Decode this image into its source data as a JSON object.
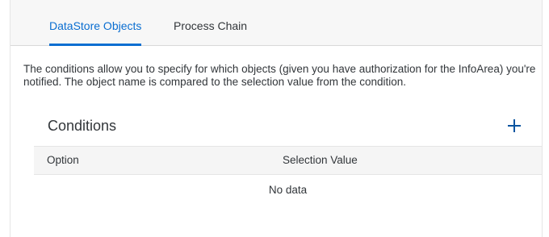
{
  "tabs": [
    {
      "label": "DataStore Objects",
      "selected": true
    },
    {
      "label": "Process Chain",
      "selected": false
    }
  ],
  "description": "The conditions allow you to specify for which objects (given you have authorization for the InfoArea) you're notified. The object name is compared to the selection value from the condition.",
  "conditions": {
    "title": "Conditions",
    "add_icon": "plus-icon",
    "columns": [
      "Option",
      "Selection Value"
    ],
    "rows": [],
    "empty_text": "No data"
  },
  "colors": {
    "accent": "#0a6ed1",
    "text": "#32363a",
    "header_bg": "#f7f7f7",
    "add_icon": "#0854a0"
  }
}
